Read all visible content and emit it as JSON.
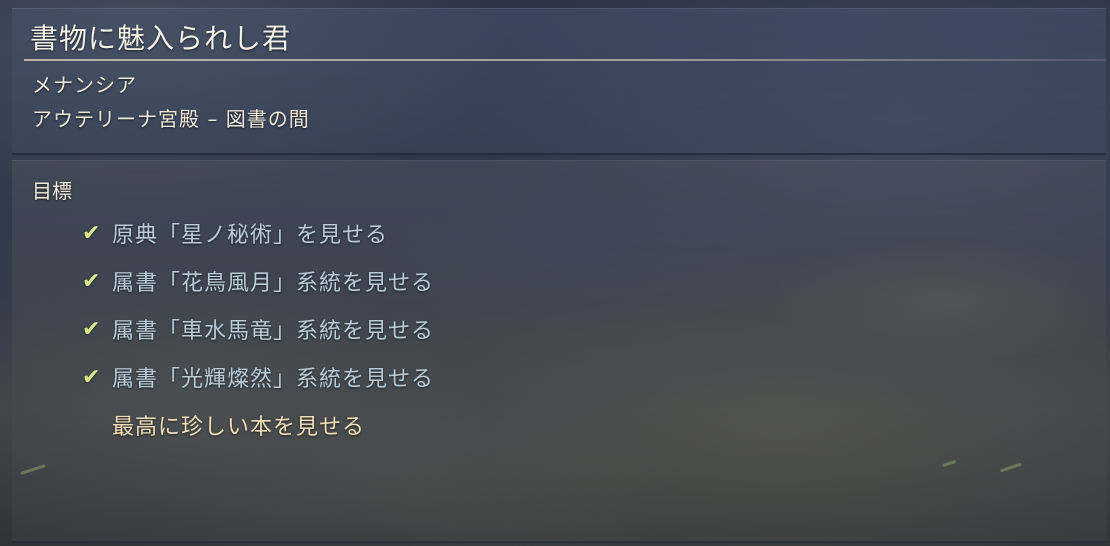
{
  "quest": {
    "title": "書物に魅入られし君",
    "region": "メナンシア",
    "location": "アウテリーナ宮殿 – 図書の間"
  },
  "objectives": {
    "heading": "目標",
    "check_icon": "✔",
    "items": [
      {
        "text": "原典「星ノ秘術」を見せる",
        "completed": true
      },
      {
        "text": "属書「花鳥風月」系統を見せる",
        "completed": true
      },
      {
        "text": "属書「車水馬竜」系統を見せる",
        "completed": true
      },
      {
        "text": "属書「光輝燦然」系統を見せる",
        "completed": true
      },
      {
        "text": "最高に珍しい本を見せる",
        "completed": false
      }
    ]
  },
  "colors": {
    "title": "#f3f1e6",
    "completed_text": "#b9ccd9",
    "pending_text": "#f0dfb6",
    "check": "#d8e88a"
  }
}
